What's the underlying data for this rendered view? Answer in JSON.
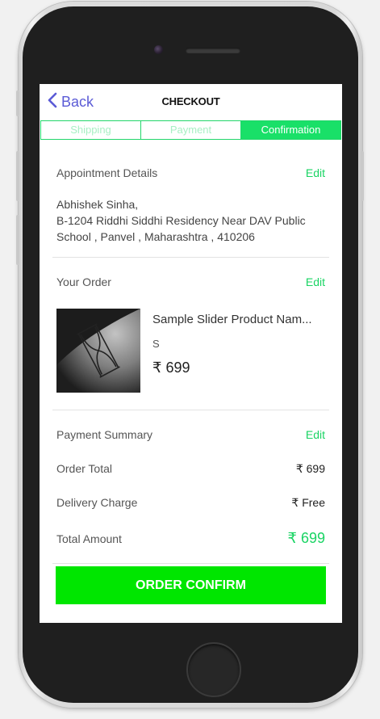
{
  "header": {
    "back_label": "Back",
    "title": "CHECKOUT"
  },
  "steps": [
    {
      "label": "Shipping",
      "active": false
    },
    {
      "label": "Payment",
      "active": false
    },
    {
      "label": "Confirmation",
      "active": true
    }
  ],
  "appointment": {
    "heading": "Appointment Details",
    "edit_label": "Edit",
    "name": "Abhishek Sinha,",
    "address": "B-1204 Riddhi Siddhi Residency Near DAV Public School , Panvel , Maharashtra , 410206"
  },
  "order": {
    "heading": "Your Order",
    "edit_label": "Edit",
    "product_name": "Sample Slider Product Nam...",
    "size": "S",
    "price": "₹ 699"
  },
  "payment_summary": {
    "heading": "Payment Summary",
    "edit_label": "Edit",
    "order_total_label": "Order Total",
    "order_total_value": "₹ 699",
    "delivery_label": "Delivery Charge",
    "delivery_value": "₹ Free",
    "total_label": "Total Amount",
    "total_value": "₹ 699"
  },
  "confirm_button": {
    "label": "ORDER CONFIRM"
  },
  "colors": {
    "accent": "#19d463",
    "confirm": "#00e600",
    "back": "#5b5bd6"
  }
}
